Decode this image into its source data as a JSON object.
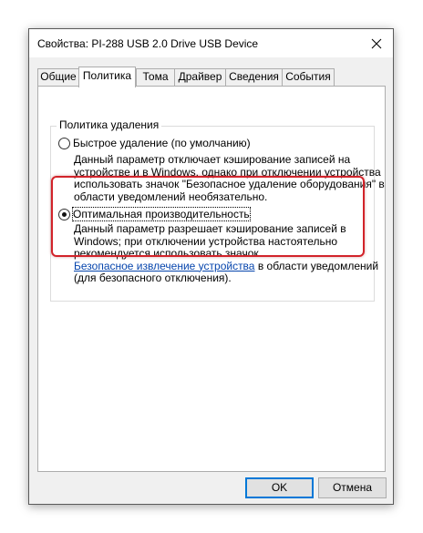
{
  "window": {
    "title": "Свойства: PI-288 USB 2.0 Drive USB Device"
  },
  "tabs": [
    {
      "label": "Общие",
      "active": false
    },
    {
      "label": "Политика",
      "active": true
    },
    {
      "label": "Тома",
      "active": false
    },
    {
      "label": "Драйвер",
      "active": false
    },
    {
      "label": "Сведения",
      "active": false
    },
    {
      "label": "События",
      "active": false
    }
  ],
  "removal_policy": {
    "group_label": "Политика удаления",
    "quick_removal": {
      "label": "Быстрое удаление (по умолчанию)",
      "selected": false,
      "description_lines": [
        "Данный параметр отключает кэширование записей на",
        "устройстве и в Windows, однако при отключении устройства",
        "использовать значок \"Безопасное удаление оборудования\" в",
        "области уведомлений необязательно."
      ]
    },
    "better_performance": {
      "label": "Оптимальная производительность",
      "selected": true,
      "description_lines": [
        "Данный параметр разрешает кэширование записей в",
        "Windows; при отключении устройства настоятельно",
        "рекомендуется использовать значок"
      ],
      "link_text": "Безопасное извлечение устройства",
      "after_link": " в области уведомлений",
      "last_line": "(для безопасного отключения)."
    }
  },
  "buttons": {
    "ok": "OK",
    "cancel": "Отмена"
  },
  "colors": {
    "highlight": "#d2232a",
    "link": "#0645ad",
    "default_button_border": "#0078d7"
  }
}
